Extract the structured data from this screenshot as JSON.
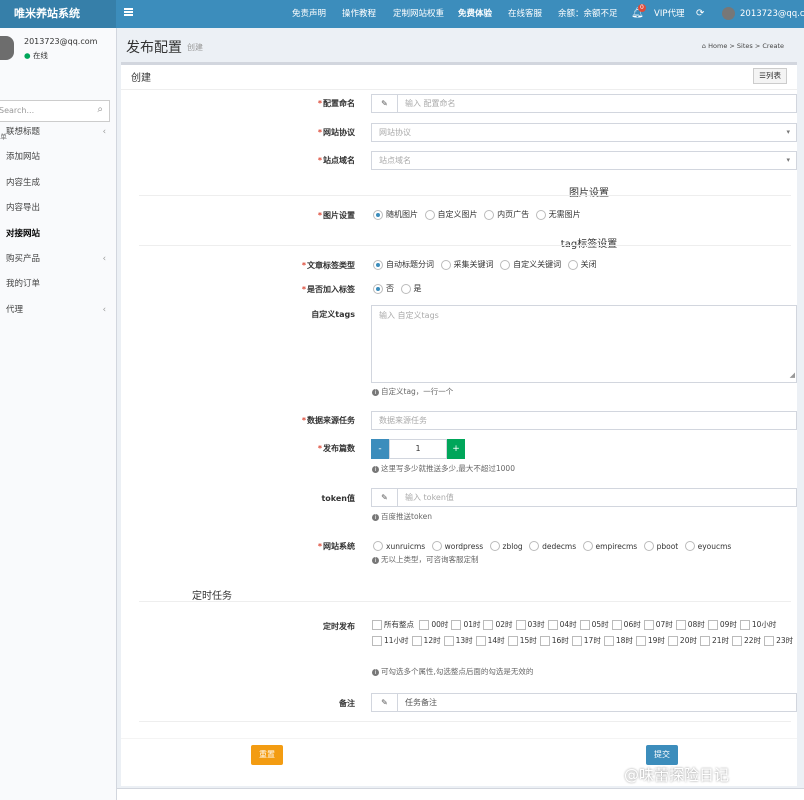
{
  "brand": "唯米养站系统",
  "topnav": [
    "免责声明",
    "操作教程",
    "定制网站权重",
    "免费体验",
    "在线客服"
  ],
  "balance": "余额：余额不足",
  "notify_count": "0",
  "vip": "VIP代理",
  "top_user": "2013723@qq.com",
  "user": {
    "email": "2013723@qq.com",
    "status": "在线"
  },
  "search_placeholder": "Search...",
  "menu_header": "单",
  "menu": [
    {
      "label": "联想标题",
      "chevron": true
    },
    {
      "label": "添加网站",
      "chevron": false
    },
    {
      "label": "内容生成",
      "chevron": false
    },
    {
      "label": "内容导出",
      "chevron": false
    },
    {
      "label": "对接网站",
      "chevron": false,
      "active": true
    },
    {
      "label": "购买产品",
      "chevron": true
    },
    {
      "label": "我的订单",
      "chevron": false
    },
    {
      "label": "代理",
      "chevron": true
    }
  ],
  "page": {
    "title": "发布配置",
    "subtitle": "创建",
    "breadcrumb": [
      "Home",
      "Sites",
      "Create"
    ]
  },
  "box_title": "创建",
  "list_button": "列表",
  "form": {
    "config_name": {
      "label": "配置命名",
      "placeholder": "输入 配置命名"
    },
    "protocol": {
      "label": "网站协议",
      "placeholder": "网站协议"
    },
    "domain": {
      "label": "站点域名",
      "placeholder": "站点域名"
    },
    "image_section": "图片设置",
    "image_setting": {
      "label": "图片设置",
      "options": [
        "随机图片",
        "自定义图片",
        "内页广告",
        "无需图片"
      ],
      "selected": 0
    },
    "tag_section": "tag标签设置",
    "tag_type": {
      "label": "文章标签类型",
      "options": [
        "自动标题分词",
        "采集关键词",
        "自定义关键词",
        "关闭"
      ],
      "selected": 0
    },
    "add_tag": {
      "label": "是否加入标签",
      "options": [
        "否",
        "是"
      ],
      "selected": 0
    },
    "custom_tags": {
      "label": "自定义tags",
      "placeholder": "输入 自定义tags",
      "help": "自定义tag，一行一个"
    },
    "source_task": {
      "label": "数据来源任务",
      "placeholder": "数据来源任务"
    },
    "post_count": {
      "label": "发布篇数",
      "value": "1",
      "minus": "-",
      "plus": "+",
      "help": "这里写多少就推送多少,最大不超过1000"
    },
    "token": {
      "label": "token值",
      "placeholder": "输入 token值",
      "help": "百度推送token"
    },
    "cms": {
      "label": "网站系统",
      "options": [
        "xunruicms",
        "wordpress",
        "zblog",
        "dedecms",
        "empirecms",
        "pboot",
        "eyoucms"
      ],
      "help": "无以上类型，可咨询客服定制"
    },
    "schedule_section": "定时任务",
    "schedule": {
      "label": "定时发布",
      "all": "所有整点",
      "hours": [
        "00时",
        "01时",
        "02时",
        "03时",
        "04时",
        "05时",
        "06时",
        "07时",
        "08时",
        "09时",
        "10小时",
        "11小时",
        "12时",
        "13时",
        "14时",
        "15时",
        "16时",
        "17时",
        "18时",
        "19时",
        "20时",
        "21时",
        "22时",
        "23时"
      ],
      "help": "可勾选多个属性,勾选整点后面的勾选是无效的"
    },
    "remark": {
      "label": "备注",
      "placeholder": "任务备注"
    }
  },
  "buttons": {
    "reset": "重置",
    "submit": "提交"
  },
  "watermark": "@味蕾探险日记",
  "colors": {
    "header": "#3c8dbc",
    "brand_bg": "#367fa9",
    "reset": "#f39c12",
    "submit": "#3c8dbc",
    "stepper_minus": "#3c8dbc",
    "stepper_plus": "#00a65a"
  }
}
